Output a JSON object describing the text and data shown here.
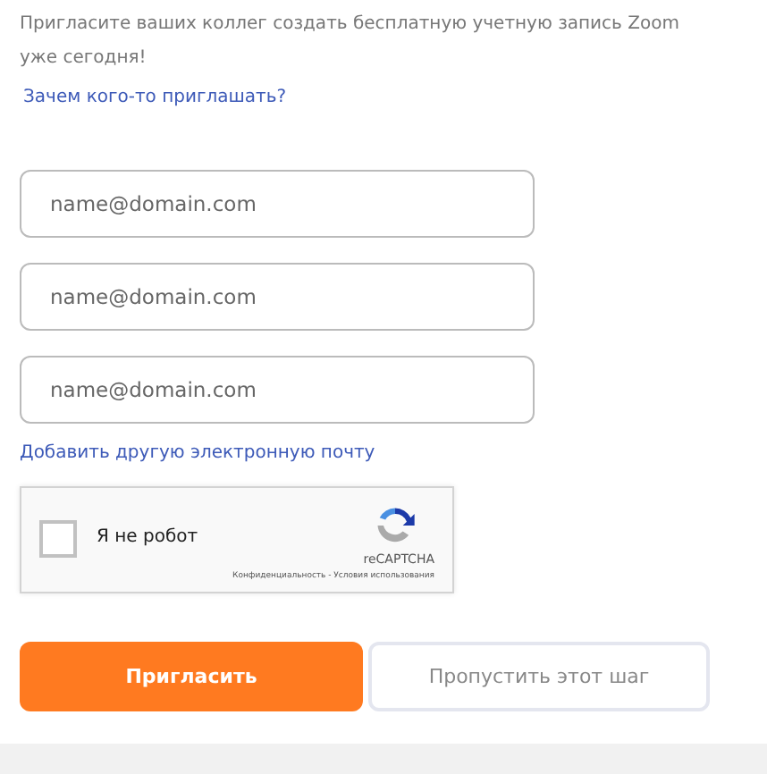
{
  "intro": "Пригласите ваших коллег создать бесплатную учетную запись Zoom уже сегодня!",
  "why_link": "Зачем кого-то приглашать?",
  "email_fields": [
    {
      "placeholder": "name@domain.com"
    },
    {
      "placeholder": "name@domain.com"
    },
    {
      "placeholder": "name@domain.com"
    }
  ],
  "add_email_link": "Добавить другую электронную почту",
  "captcha": {
    "label": "Я не робот",
    "checked": false,
    "brand": "reCAPTCHA",
    "footer": "Конфиденциальность - Условия использования"
  },
  "buttons": [
    {
      "kind": "primary",
      "label": "Пригласить"
    },
    {
      "kind": "secondary",
      "label": "Пропустить этот шаг"
    }
  ]
}
